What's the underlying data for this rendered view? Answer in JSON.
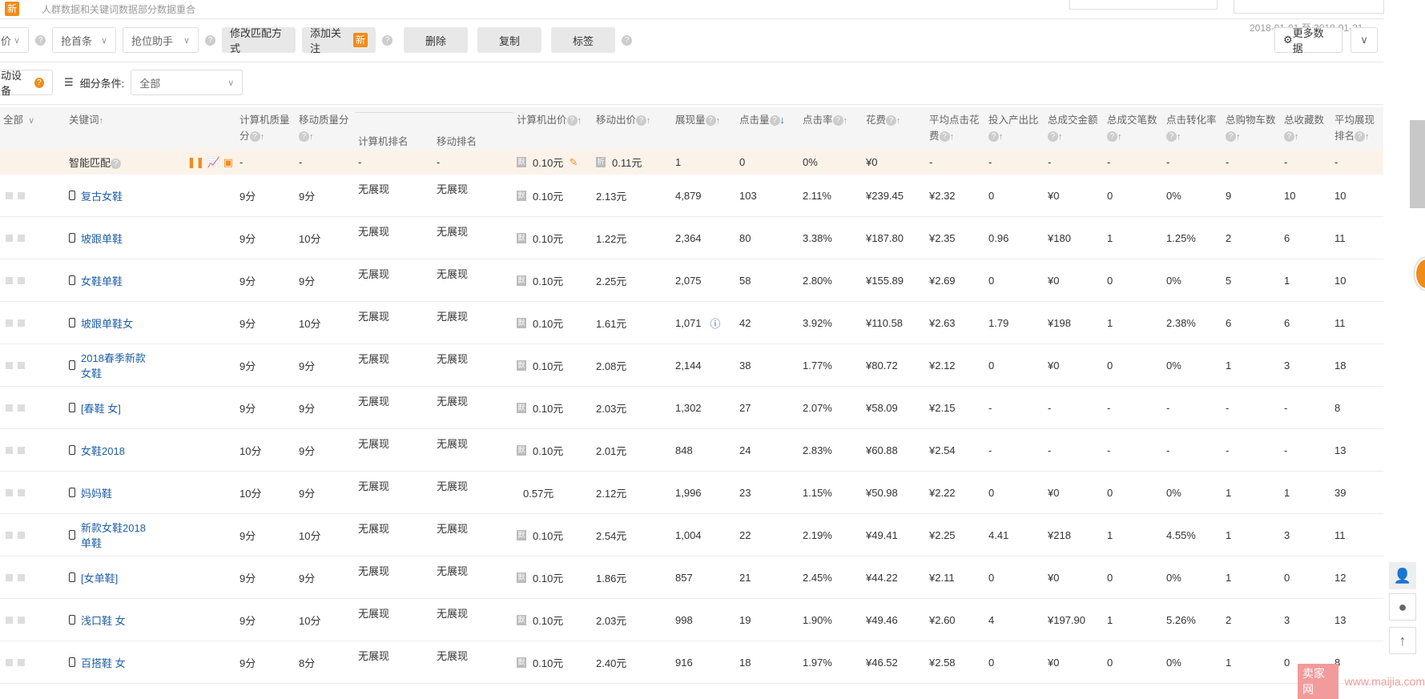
{
  "top": {
    "new_badge": "新",
    "notice": "人群数据和关键词数据部分数据重合"
  },
  "date_range": "2018-01-01 至 2018-01-31",
  "toolbar": {
    "select1": "价",
    "select2": "抢首条",
    "select3": "抢位助手",
    "modify_match": "修改匹配方式",
    "add_follow": "添加关注",
    "new_badge": "新",
    "delete": "删除",
    "copy": "复制",
    "tag": "标签",
    "more_data": "更多数据"
  },
  "filter": {
    "device": "动设备",
    "condition_label": "细分条件:",
    "condition_value": "全部"
  },
  "headers": [
    "全部",
    "关键词",
    "计算机质量分",
    "移动质量分",
    "计算机排名",
    "移动排名",
    "计算机出价",
    "移动出价",
    "展现量",
    "点击量",
    "点击率",
    "花费",
    "平均点击花费",
    "投入产出比",
    "总成交金额",
    "总成交笔数",
    "点击转化率",
    "总购物车数",
    "总收藏数",
    "平均展现排名"
  ],
  "smart_row": {
    "keyword": "智能匹配",
    "cells": [
      "-",
      "-",
      "-",
      "-",
      "0.10元",
      "0.11元",
      "1",
      "0",
      "0%",
      "¥0",
      "-",
      "-",
      "-",
      "-",
      "-",
      "-",
      "-",
      "-"
    ],
    "pc_badge": "默",
    "mobile_badge": "折"
  },
  "rows": [
    [
      "复古女鞋",
      "9分",
      "9分",
      "无展现",
      "无展现",
      "0.10元",
      "2.13元",
      "4,879",
      "103",
      "2.11%",
      "¥239.45",
      "¥2.32",
      "0",
      "¥0",
      "0",
      "0%",
      "9",
      "10",
      "10"
    ],
    [
      "坡跟单鞋",
      "9分",
      "10分",
      "无展现",
      "无展现",
      "0.10元",
      "1.22元",
      "2,364",
      "80",
      "3.38%",
      "¥187.80",
      "¥2.35",
      "0.96",
      "¥180",
      "1",
      "1.25%",
      "2",
      "6",
      "11"
    ],
    [
      "女鞋单鞋",
      "9分",
      "9分",
      "无展现",
      "无展现",
      "0.10元",
      "2.25元",
      "2,075",
      "58",
      "2.80%",
      "¥155.89",
      "¥2.69",
      "0",
      "¥0",
      "0",
      "0%",
      "5",
      "1",
      "10"
    ],
    [
      "坡跟单鞋女",
      "9分",
      "10分",
      "无展现",
      "无展现",
      "0.10元",
      "1.61元",
      "1,071",
      "42",
      "3.92%",
      "¥110.58",
      "¥2.63",
      "1.79",
      "¥198",
      "1",
      "2.38%",
      "6",
      "6",
      "11"
    ],
    [
      "2018春季新款女鞋",
      "9分",
      "9分",
      "无展现",
      "无展现",
      "0.10元",
      "2.08元",
      "2,144",
      "38",
      "1.77%",
      "¥80.72",
      "¥2.12",
      "0",
      "¥0",
      "0",
      "0%",
      "1",
      "3",
      "18"
    ],
    [
      "[春鞋 女]",
      "9分",
      "9分",
      "无展现",
      "无展现",
      "0.10元",
      "2.03元",
      "1,302",
      "27",
      "2.07%",
      "¥58.09",
      "¥2.15",
      "-",
      "-",
      "-",
      "-",
      "-",
      "-",
      "8"
    ],
    [
      "女鞋2018",
      "10分",
      "9分",
      "无展现",
      "无展现",
      "0.10元",
      "2.01元",
      "848",
      "24",
      "2.83%",
      "¥60.88",
      "¥2.54",
      "-",
      "-",
      "-",
      "-",
      "-",
      "-",
      "13"
    ],
    [
      "妈妈鞋",
      "10分",
      "9分",
      "无展现",
      "无展现",
      "0.57元",
      "2.12元",
      "1,996",
      "23",
      "1.15%",
      "¥50.98",
      "¥2.22",
      "0",
      "¥0",
      "0",
      "0%",
      "1",
      "1",
      "39"
    ],
    [
      "新款女鞋2018单鞋",
      "9分",
      "10分",
      "无展现",
      "无展现",
      "0.10元",
      "2.54元",
      "1,004",
      "22",
      "2.19%",
      "¥49.41",
      "¥2.25",
      "4.41",
      "¥218",
      "1",
      "4.55%",
      "1",
      "3",
      "11"
    ],
    [
      "[女单鞋]",
      "9分",
      "9分",
      "无展现",
      "无展现",
      "0.10元",
      "1.86元",
      "857",
      "21",
      "2.45%",
      "¥44.22",
      "¥2.11",
      "0",
      "¥0",
      "0",
      "0%",
      "1",
      "0",
      "12"
    ],
    [
      "浅口鞋 女",
      "9分",
      "10分",
      "无展现",
      "无展现",
      "0.10元",
      "2.03元",
      "998",
      "19",
      "1.90%",
      "¥49.46",
      "¥2.60",
      "4",
      "¥197.90",
      "1",
      "5.26%",
      "2",
      "3",
      "13"
    ],
    [
      "百搭鞋 女",
      "9分",
      "8分",
      "无展现",
      "无展现",
      "0.10元",
      "2.40元",
      "916",
      "18",
      "1.97%",
      "¥46.52",
      "¥2.58",
      "0",
      "¥0",
      "0",
      "0%",
      "1",
      "0",
      "8"
    ]
  ],
  "default_badge": "默",
  "watermark": "卖家网 www.maijia.com",
  "accent": "#f08c1a",
  "link": "#1f5fa8"
}
